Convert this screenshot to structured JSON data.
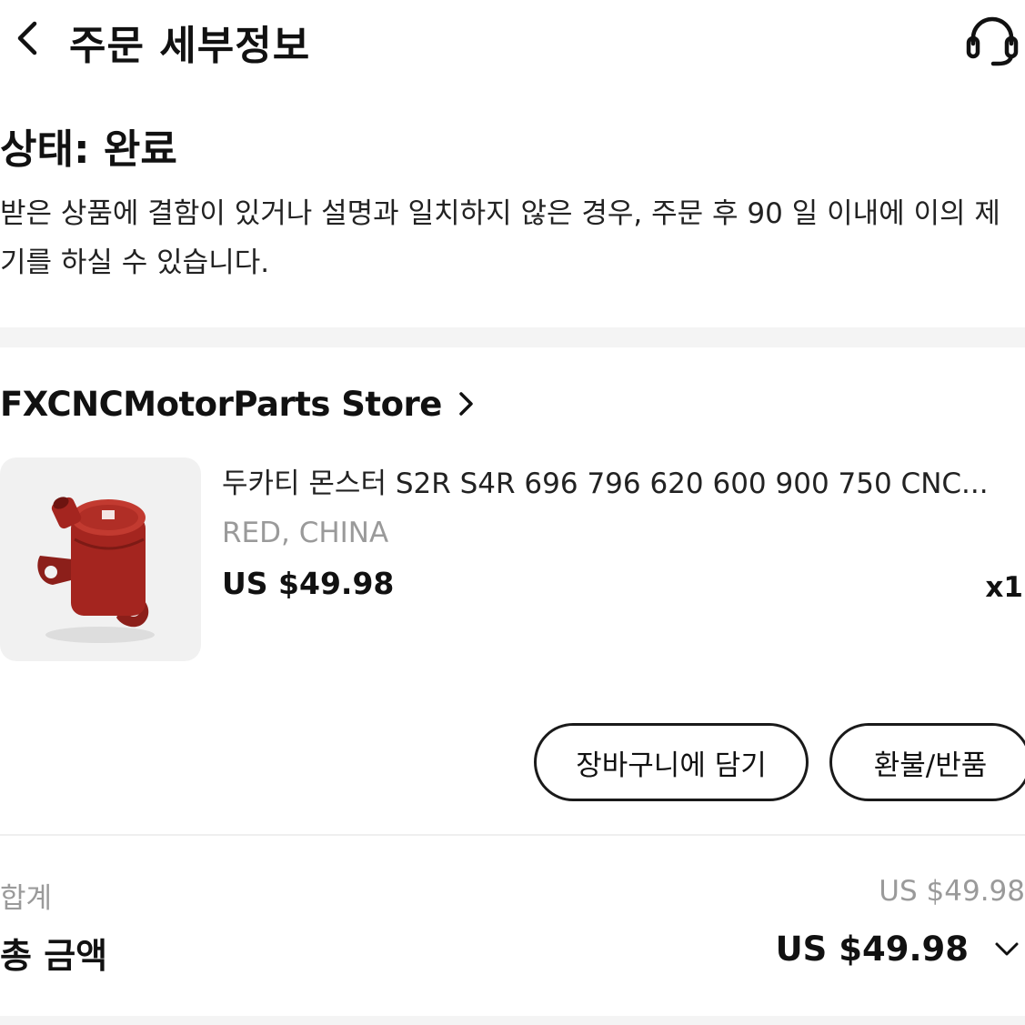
{
  "header": {
    "title": "주문 세부정보",
    "back_icon": "chevron-left-icon",
    "support_icon": "headset-icon"
  },
  "status": {
    "title": "상태: 완료",
    "description": "받은 상품에 결함이 있거나 설명과 일치하지 않은 경우, 주문 후 90 일 이내에 이의 제기를 하실 수 있습니다."
  },
  "store": {
    "name": "FXCNCMotorParts Store",
    "chevron_icon": "chevron-right-icon"
  },
  "product": {
    "title": "두카티 몬스터 S2R S4R 696 796 620 600 900 750 CNC...",
    "variant": "RED, CHINA",
    "price": "US $49.98",
    "quantity": "x1",
    "image_color": "#a4251f"
  },
  "actions": {
    "add_to_cart": "장바구니에 담기",
    "refund_return": "환불/반품"
  },
  "summary": {
    "subtotal_label": "합계",
    "subtotal_value": "US $49.98",
    "total_label": "총 금액",
    "total_value": "US $49.98",
    "expand_icon": "chevron-down-icon"
  },
  "colors": {
    "text": "#111111",
    "muted": "#9a9a9a",
    "divider": "#f4f4f4",
    "product_red": "#a4251f"
  }
}
